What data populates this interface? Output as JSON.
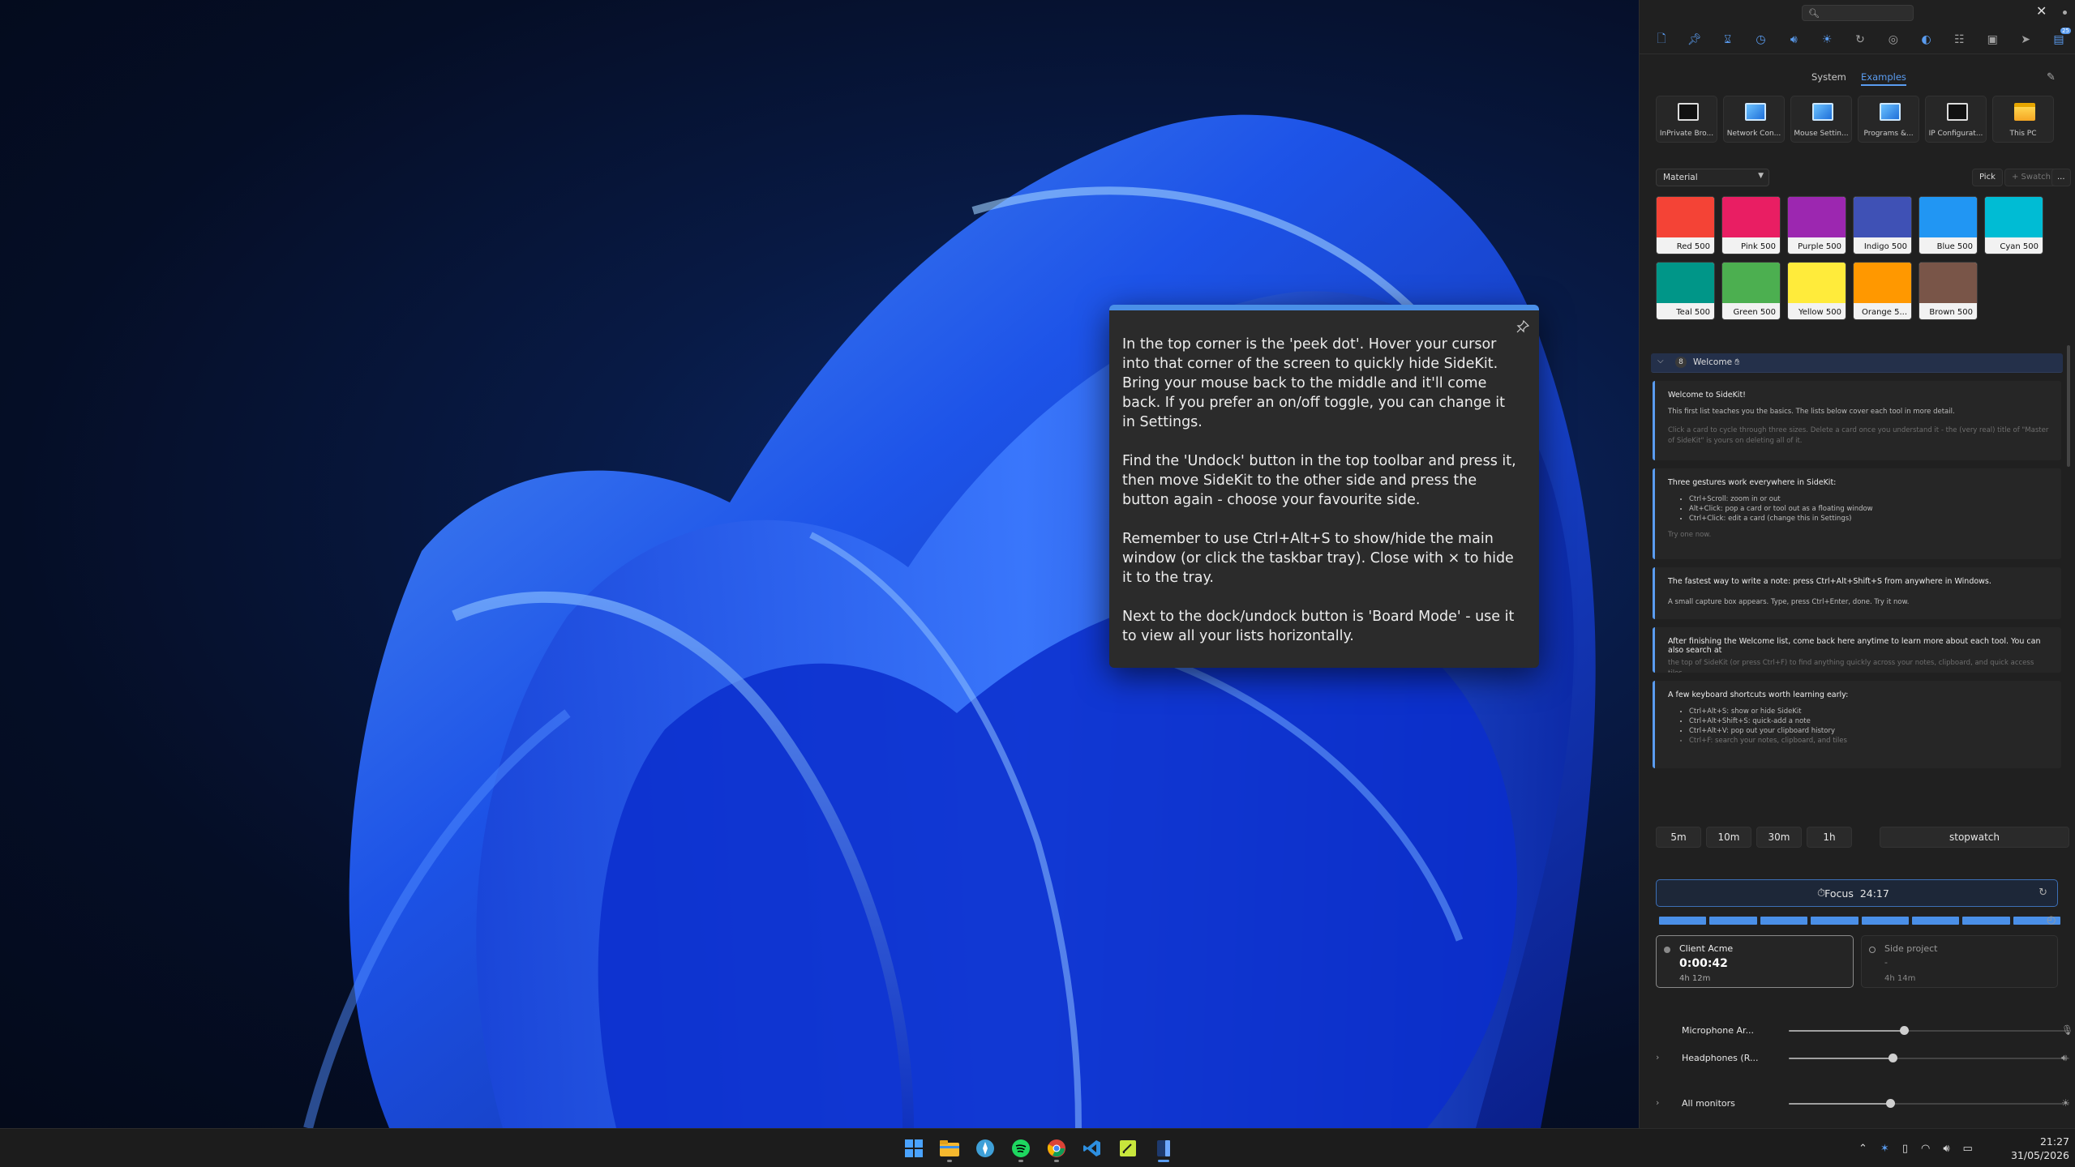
{
  "tooltip": {
    "paragraphs": [
      "In the top corner is the 'peek dot'. Hover your cursor into that corner of the screen to quickly hide SideKit. Bring your mouse back to the middle and it'll come back. If you prefer an on/off toggle, you can change it in Settings.",
      "Find the 'Undock' button in the top toolbar and press it, then move SideKit to the other side and press the button again - choose your favourite side.",
      "Remember to use Ctrl+Alt+S to show/hide the main window (or click the taskbar tray). Close with × to hide it to the tray.",
      "Next to the dock/undock button is 'Board Mode' - use it to view all your lists horizontally."
    ]
  },
  "sidebar": {
    "toolbar_icons": [
      "note-icon",
      "pin-icon",
      "hourglass-icon",
      "clock-icon",
      "volume-icon",
      "brightness-icon",
      "sync-icon",
      "sound-icon",
      "palette-icon",
      "apps-icon",
      "key-icon",
      "cursor-icon",
      "dock-icon"
    ],
    "toolbar_badge": "25",
    "tabs": [
      "System",
      "Examples"
    ],
    "shortcuts": [
      {
        "label": "InPrivate Bro...",
        "icon": "terminal-icon"
      },
      {
        "label": "Network Con...",
        "icon": "control-panel-icon"
      },
      {
        "label": "Mouse Settin...",
        "icon": "control-panel-icon"
      },
      {
        "label": "Programs &...",
        "icon": "control-panel-icon"
      },
      {
        "label": "IP Configurat...",
        "icon": "terminal-icon"
      },
      {
        "label": "This PC",
        "icon": "folder-icon"
      }
    ],
    "palette": {
      "selected": "Material",
      "pick_label": "Pick",
      "swatch_label": "+ Swatch",
      "more_label": "...",
      "swatches": [
        {
          "name": "Red 500",
          "color": "#f44336"
        },
        {
          "name": "Pink 500",
          "color": "#e91e63"
        },
        {
          "name": "Purple 500",
          "color": "#9c27b0"
        },
        {
          "name": "Indigo 500",
          "color": "#3f51b5"
        },
        {
          "name": "Blue 500",
          "color": "#2196f3"
        },
        {
          "name": "Cyan 500",
          "color": "#00bcd4"
        },
        {
          "name": "Teal 500",
          "color": "#009688"
        },
        {
          "name": "Green 500",
          "color": "#4caf50"
        },
        {
          "name": "Yellow 500",
          "color": "#ffeb3b"
        },
        {
          "name": "Orange 5...",
          "color": "#ff9800"
        },
        {
          "name": "Brown 500",
          "color": "#795548"
        }
      ]
    },
    "welcome": {
      "count": "8",
      "title": "Welcome",
      "cards": [
        {
          "heading": "Welcome to SideKit!",
          "body": "This first list teaches you the basics. The lists below cover each tool in more detail.",
          "faded": "Click a card to cycle through three sizes. Delete a card once you understand it - the (very real) title of \"Master of SideKit\" is yours on deleting all of it."
        },
        {
          "heading": "Three gestures work everywhere in SideKit:",
          "items": [
            "Ctrl+Scroll: zoom in or out",
            "Alt+Click: pop a card or tool out as a floating window",
            "Ctrl+Click: edit a card (change this in Settings)"
          ],
          "faded": "Try one now."
        },
        {
          "heading": "The fastest way to write a note: press Ctrl+Alt+Shift+S from anywhere in Windows.",
          "body": "A small capture box appears. Type, press Ctrl+Enter, done. Try it now."
        },
        {
          "heading": "After finishing the Welcome list, come back here anytime to learn more about each tool. You can also search at",
          "faded": "the top of SideKit (or press Ctrl+F) to find anything quickly across your notes, clipboard, and quick access tiles."
        },
        {
          "heading": "A few keyboard shortcuts worth learning early:",
          "items": [
            "Ctrl+Alt+S: show or hide SideKit",
            "Ctrl+Alt+Shift+S: quick-add a note",
            "Ctrl+Alt+V: pop out your clipboard history",
            "Ctrl+F: search your notes, clipboard, and tiles"
          ]
        }
      ]
    },
    "timers": [
      "5m",
      "10m",
      "30m",
      "1h"
    ],
    "stopwatch_label": "stopwatch",
    "focus": {
      "label": "Focus",
      "time": "24:17",
      "progress_segments_filled": 8,
      "progress_segments_total": 8
    },
    "tracks": [
      {
        "name": "Client Acme",
        "time": "0:00:42",
        "total": "4h 12m",
        "active": true
      },
      {
        "name": "Side project",
        "time": "-",
        "total": "4h 14m",
        "active": false
      }
    ],
    "audio": [
      {
        "name": "Microphone Ar...",
        "level": 0.41,
        "icon": "mic-icon"
      },
      {
        "name": "Headphones (R...",
        "level": 0.37,
        "icon": "speaker-icon"
      },
      {
        "name": "All monitors",
        "level": 0.36,
        "icon": "sun-icon"
      }
    ]
  },
  "taskbar": {
    "apps": [
      "windows-start-icon",
      "file-explorer-icon",
      "browser-icon",
      "spotify-icon",
      "chrome-icon",
      "vscode-icon",
      "notepad-icon",
      "sidekit-icon"
    ],
    "tray_icons": [
      "chevron-up-icon",
      "bluetooth-icon",
      "tablet-icon",
      "wifi-icon",
      "volume-icon",
      "battery-icon"
    ],
    "time": "21:27",
    "date": "31/05/2026"
  }
}
